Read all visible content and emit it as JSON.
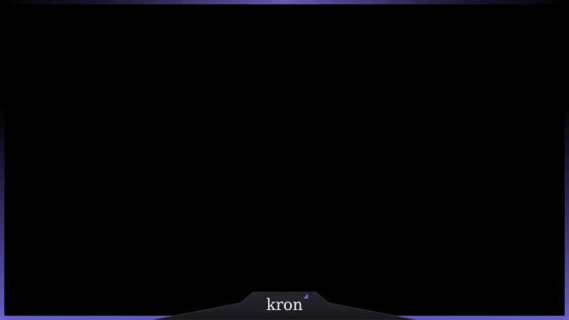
{
  "brand": {
    "name": "kron",
    "logo_icon": "kron-logo-mark"
  },
  "colors": {
    "background": "#000000",
    "frame_accent": "#6e64d2",
    "tab_fill": "#1e1e24",
    "brand_text": "#ffffff",
    "brand_mark": "#6f63d6"
  }
}
